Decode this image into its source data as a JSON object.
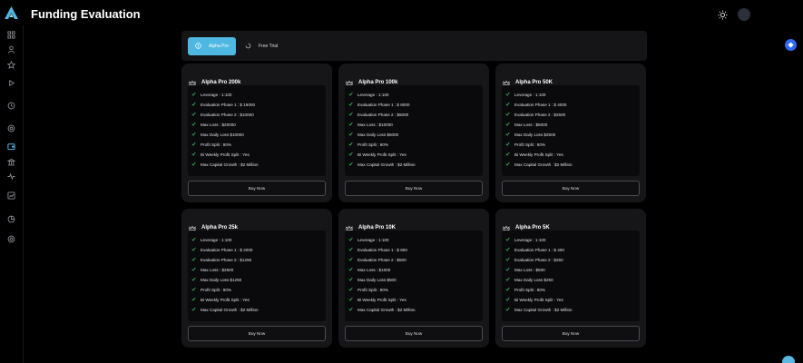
{
  "header": {
    "title": "Funding Evaluation"
  },
  "icons": {
    "logo": "triangle-logo",
    "theme": "sun-icon",
    "settings": "gear-icon",
    "sidebar": [
      "grid-icon",
      "user-icon",
      "star-icon",
      "play-icon",
      "history-icon",
      "target-icon",
      "wallet-icon",
      "bank-icon",
      "activity-icon",
      "chart-icon",
      "pie-icon",
      "support-icon"
    ]
  },
  "tabs": [
    {
      "label": "Alpha Pro",
      "active": true
    },
    {
      "label": "Free Trial",
      "active": false
    }
  ],
  "colors": {
    "accent": "#4fb8e2",
    "check": "#37c26b",
    "float": "#2f6af5"
  },
  "plans": [
    {
      "name": "Alpha Pro 200k",
      "features": [
        "Leverage : 1:100",
        "Evaluation Phase 1 : $ 16000",
        "Evaluation Phase 2 : $10000",
        "Max Loss : $20000",
        "Max Daily Loss $10000",
        "Profit Split : 80%",
        "Bi Weekly Profit Split : Yes",
        "Max Capital Growth : $2 Million"
      ],
      "button": "Buy Now"
    },
    {
      "name": "Alpha Pro 100k",
      "features": [
        "Leverage : 1:100",
        "Evaluation Phase 1 : $ 8000",
        "Evaluation Phase 2 : $5000",
        "Max Loss : $10000",
        "Max Daily Loss $5000",
        "Profit Split : 80%",
        "Bi Weekly Profit Split : Yes",
        "Max Capital Growth : $2 Million"
      ],
      "button": "Buy Now"
    },
    {
      "name": "Alpha Pro 50K",
      "features": [
        "Leverage : 1:100",
        "Evaluation Phase 1 : $ 4000",
        "Evaluation Phase 2 : $2500",
        "Max Loss : $5000",
        "Max Daily Loss $2500",
        "Profit Split : 80%",
        "Bi Weekly Profit Split : Yes",
        "Max Capital Growth : $2 Million"
      ],
      "button": "Buy Now"
    },
    {
      "name": "Alpha Pro 25k",
      "features": [
        "Leverage : 1:100",
        "Evaluation Phase 1 : $ 2000",
        "Evaluation Phase 2 : $1250",
        "Max Loss : $2500",
        "Max Daily Loss $1250",
        "Profit Split : 80%",
        "Bi Weekly Profit Split : Yes",
        "Max Capital Growth : $2 Million"
      ],
      "button": "Buy Now"
    },
    {
      "name": "Alpha Pro 10K",
      "features": [
        "Leverage : 1:100",
        "Evaluation Phase 1 : $ 800",
        "Evaluation Phase 2 : $500",
        "Max Loss : $1000",
        "Max Daily Loss $500",
        "Profit Split : 80%",
        "Bi Weekly Profit Split : Yes",
        "Max Capital Growth : $2 Million"
      ],
      "button": "Buy Now"
    },
    {
      "name": "Alpha Pro 5K",
      "features": [
        "Leverage : 1:100",
        "Evaluation Phase 1 : $ 400",
        "Evaluation Phase 2 : $250",
        "Max Loss : $500",
        "Max Daily Loss $250",
        "Profit Split : 80%",
        "Bi Weekly Profit Split : Yes",
        "Max Capital Growth : $2 Million"
      ],
      "button": "Buy Now"
    }
  ]
}
